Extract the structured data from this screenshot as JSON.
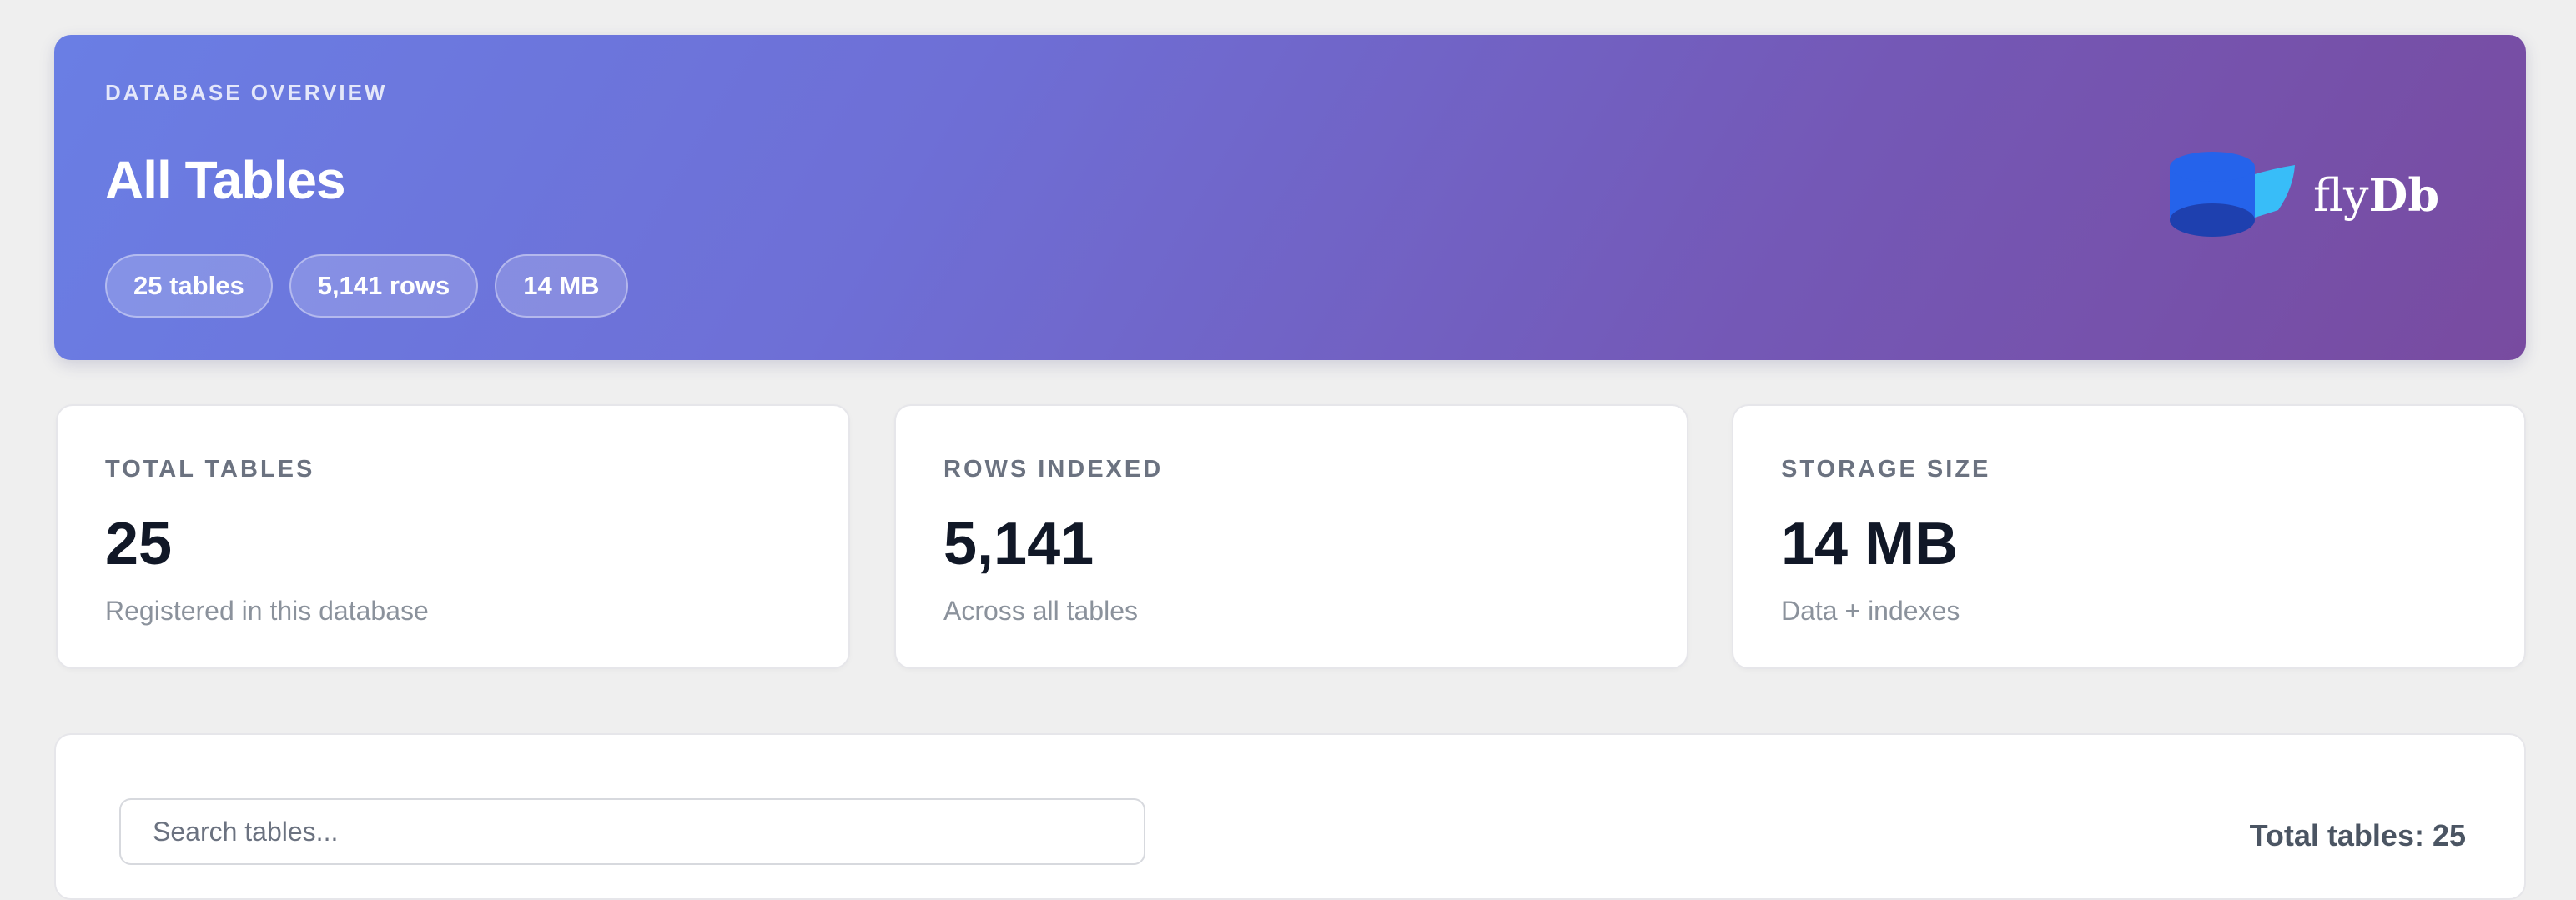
{
  "header": {
    "eyebrow": "DATABASE OVERVIEW",
    "title": "All Tables",
    "pills": [
      "25 tables",
      "5,141 rows",
      "14 MB"
    ],
    "brand": {
      "prefix": "fly",
      "suffix": "Db",
      "logo_icon": "database-cylinder-icon"
    }
  },
  "stats": [
    {
      "label": "TOTAL TABLES",
      "value": "25",
      "sub": "Registered in this database"
    },
    {
      "label": "ROWS INDEXED",
      "value": "5,141",
      "sub": "Across all tables"
    },
    {
      "label": "STORAGE SIZE",
      "value": "14 MB",
      "sub": "Data + indexes"
    }
  ],
  "table_panel": {
    "search_placeholder": "Search tables...",
    "total_label": "Total tables: 25"
  },
  "colors": {
    "hero_gradient_start": "#6a7ee4",
    "hero_gradient_end": "#784ba0",
    "logo_blue": "#2563eb",
    "logo_light": "#38bdf8",
    "page_bg": "#efefef"
  }
}
